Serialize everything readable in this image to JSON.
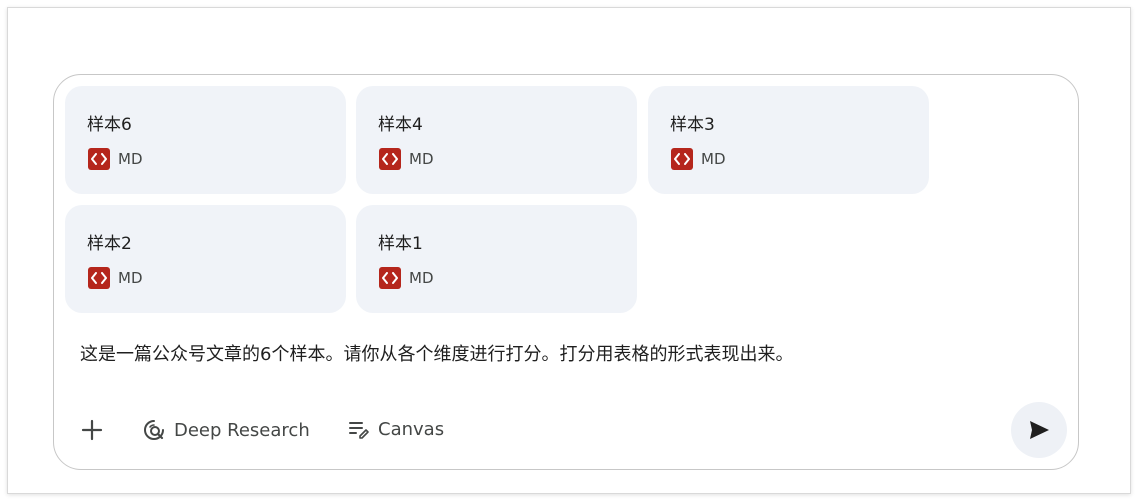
{
  "attachments": [
    {
      "name": "样本6",
      "type": "MD",
      "icon": "code-file-icon"
    },
    {
      "name": "样本4",
      "type": "MD",
      "icon": "code-file-icon"
    },
    {
      "name": "样本3",
      "type": "MD",
      "icon": "code-file-icon"
    },
    {
      "name": "样本2",
      "type": "MD",
      "icon": "code-file-icon"
    },
    {
      "name": "样本1",
      "type": "MD",
      "icon": "code-file-icon"
    }
  ],
  "prompt": {
    "text": "这是一篇公众号文章的6个样本。请你从各个维度进行打分。打分用表格的形式表现出来。"
  },
  "toolbar": {
    "add_icon": "plus-icon",
    "deep_research_label": "Deep Research",
    "deep_research_icon": "deep-research-icon",
    "canvas_label": "Canvas",
    "canvas_icon": "canvas-icon",
    "send_icon": "send-icon"
  },
  "colors": {
    "card_background": "#f0f3f8",
    "md_icon_background": "#b5261c",
    "text_primary": "#1f1f1f",
    "text_secondary": "#444746",
    "send_button_background": "#eef1f6"
  }
}
